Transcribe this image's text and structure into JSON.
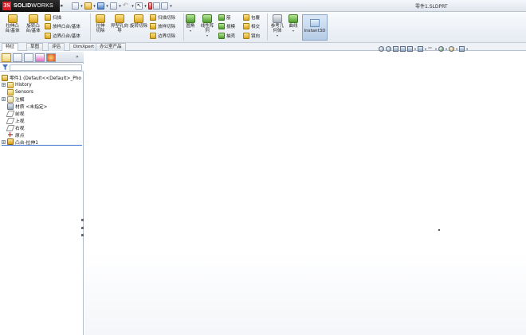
{
  "app": {
    "logo_mark": "3S",
    "logo_name_bold": "SOLID",
    "logo_name_light": "WORKS",
    "window_title": "零件1.SLDPRT"
  },
  "ribbon": {
    "extrude_boss": "拉伸凸台/基体",
    "revolve_boss": "旋转凸台/基体",
    "sweep": "扫描",
    "loft_boss": "放样凸台/基体",
    "boundary_boss": "边界凸台/基体",
    "extrude_cut": "拉伸切除",
    "hole_wizard": "异型孔向导",
    "revolve_cut": "旋转切除",
    "swept_cut": "扫描切除",
    "lofted_cut": "放样切除",
    "boundary_cut": "边界切除",
    "fillet": "圆角",
    "linear_pattern": "线性阵列",
    "rib": "筋",
    "draft": "拔模",
    "shell": "抽壳",
    "wrap": "包覆",
    "intersect": "相交",
    "mirror": "镜向",
    "ref_geometry": "参考几何体",
    "curves": "曲线",
    "instant3d": "Instant3D"
  },
  "tabs": [
    "特征",
    "草图",
    "评估",
    "DimXpert",
    "办公室产品"
  ],
  "tree": {
    "root": "零件1  (Default<<Default>_Pho",
    "history": "History",
    "sensors": "Sensors",
    "annotations": "注解",
    "material": "材质 <未指定>",
    "front_plane": "前视",
    "top_plane": "上视",
    "right_plane": "右视",
    "origin": "原点",
    "feature": "凸台-拉伸1"
  }
}
